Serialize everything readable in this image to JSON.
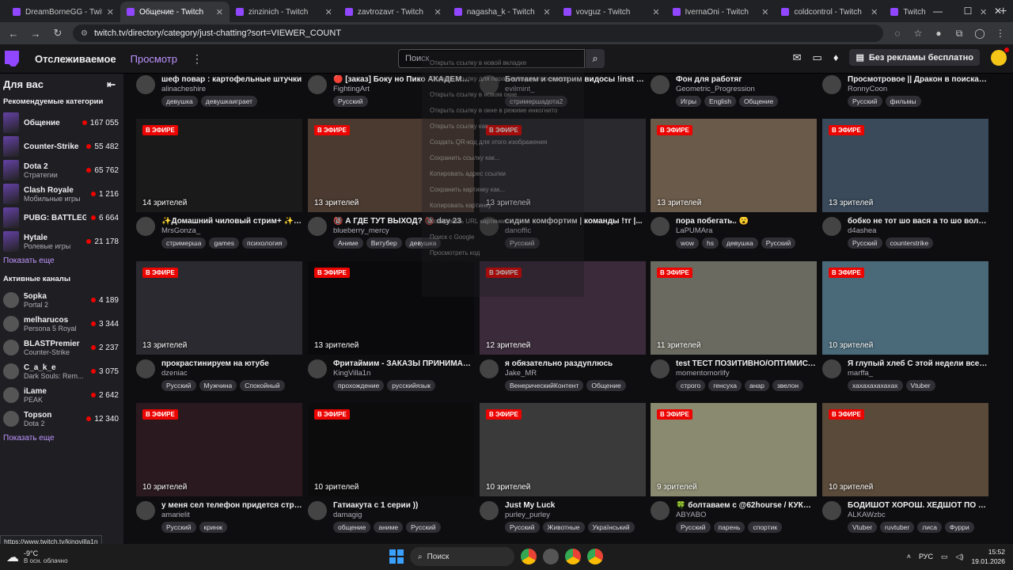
{
  "browser": {
    "tabs": [
      {
        "title": "DreamBorneGG - Twitch",
        "active": false
      },
      {
        "title": "Общение - Twitch",
        "active": true
      },
      {
        "title": "zinzinich - Twitch",
        "active": false
      },
      {
        "title": "zavtrozavr - Twitch",
        "active": false
      },
      {
        "title": "nagasha_k - Twitch",
        "active": false
      },
      {
        "title": "vovguz - Twitch",
        "active": false
      },
      {
        "title": "IvernaOni - Twitch",
        "active": false
      },
      {
        "title": "coldcontrol - Twitch",
        "active": false
      },
      {
        "title": "Twitch",
        "active": false
      }
    ],
    "url": "twitch.tv/directory/category/just-chatting?sort=VIEWER_COUNT",
    "status_url": "https://www.twitch.tv/kingvilla1n"
  },
  "header": {
    "following": "Отслеживаемое",
    "browse": "Просмотр",
    "search_placeholder": "Поиск",
    "no_ads": "Без рекламы бесплатно"
  },
  "sidebar": {
    "title": "Для вас",
    "rec_title": "Рекомендуемые категории",
    "categories": [
      {
        "name": "Общение",
        "meta": "",
        "count": "167 055"
      },
      {
        "name": "Counter-Strike",
        "meta": "",
        "count": "55 482"
      },
      {
        "name": "Dota 2",
        "meta": "Стратегии",
        "count": "65 762"
      },
      {
        "name": "Clash Royale",
        "meta": "Мобильные игры",
        "count": "1 216"
      },
      {
        "name": "PUBG: BATTLEG...",
        "meta": "",
        "count": "6 664"
      },
      {
        "name": "Hytale",
        "meta": "Ролевые игры",
        "count": "21 178"
      }
    ],
    "show_more": "Показать еще",
    "active_title": "Активные каналы",
    "channels": [
      {
        "name": "5opka",
        "meta": "Portal 2",
        "count": "4 189"
      },
      {
        "name": "melharucos",
        "meta": "Persona 5 Royal",
        "count": "3 344"
      },
      {
        "name": "BLASTPremier",
        "meta": "Counter-Strike",
        "count": "2 237"
      },
      {
        "name": "C_a_k_e",
        "meta": "Dark Souls: Rem...",
        "count": "3 075"
      },
      {
        "name": "iLame",
        "meta": "PEAK",
        "count": "2 642"
      },
      {
        "name": "Topson",
        "meta": "Dota 2",
        "count": "12 340"
      }
    ],
    "show_more2": "Показать еще"
  },
  "top_row": [
    {
      "title": "шеф повар : картофельные штучки",
      "name": "alinacheshire",
      "tags": [
        "девушка",
        "девушкаиграет"
      ]
    },
    {
      "title": "🔴 [заказ] Боку но Пико АКАДЕМИЯ ...",
      "name": "FightingArt",
      "tags": [
        "Русский"
      ]
    },
    {
      "title": "Болтаем и смотрим видосы !inst !tg ...",
      "name": "evilmint_",
      "tags": [
        "",
        "стримершадота2"
      ]
    },
    {
      "title": "Фон для работяг",
      "name": "Geometric_Progression",
      "tags": [
        "Игры",
        "English",
        "Общение"
      ]
    },
    {
      "title": "Просмотровое || Дракон в поисках ...",
      "name": "RonnyCoon",
      "tags": [
        "Русский",
        "фильмы"
      ]
    }
  ],
  "live_label": "В ЭФИРЕ",
  "rows": [
    [
      {
        "viewers": "14 зрителей",
        "title": "✨Домашний чиловый стрим+ ✨Ib...",
        "name": "MrsGonza_",
        "tags": [
          "стримерша",
          "games",
          "психология"
        ],
        "color": "#1a1a1a"
      },
      {
        "viewers": "13 зрителей",
        "title": "🔞 А ГДЕ ТУТ ВЫХОД? 🔞 day 23",
        "name": "blueberry_mercy",
        "tags": [
          "Аниме",
          "Витубер",
          "девушка"
        ],
        "color": "#4a3a30"
      },
      {
        "viewers": "13 зрителей",
        "title": "сидим комфортим | команды !тг |...",
        "name": "danoffic",
        "tags": [
          "Русский"
        ],
        "color": "#2a2a2e"
      },
      {
        "viewers": "13 зрителей",
        "title": "пора побегать.. 😮",
        "name": "LaPUMAra",
        "tags": [
          "wow",
          "hs",
          "девушка",
          "Русский"
        ],
        "color": "#6a5a4a"
      },
      {
        "viewers": "13 зрителей",
        "title": "бобко не тот шо вася а то шо волк | l...",
        "name": "d4ashea",
        "tags": [
          "Русский",
          "counterstrike"
        ],
        "color": "#3a4a5a"
      }
    ],
    [
      {
        "viewers": "13 зрителей",
        "title": "прокрастинируем на ютубе",
        "name": "dzeniac",
        "tags": [
          "Русский",
          "Мужчина",
          "Спокойный"
        ],
        "color": "#2a2a30"
      },
      {
        "viewers": "13 зрителей",
        "title": "Фритаймим - ЗАКАЗЫ ПРИНИМАЮ...",
        "name": "KingVilla1n",
        "tags": [
          "прохождение",
          "русскийязык"
        ],
        "color": "#0a0a0c"
      },
      {
        "viewers": "12 зрителей",
        "title": "я обязательно раздуплюсь",
        "name": "Jake_MR",
        "tags": [
          "ВенерическийКонтент",
          "Общение"
        ],
        "color": "#3a2a3a"
      },
      {
        "viewers": "11 зрителей",
        "title": "test ТЕСТ ПОЗИТИВНО/ОПТИМИСТ...",
        "name": "momentomorlify",
        "tags": [
          "строго",
          "генсуха",
          "анар",
          "звелон"
        ],
        "color": "#6a6a60"
      },
      {
        "viewers": "10 зрителей",
        "title": "Я глупый хлеб С этой недели все бу...",
        "name": "marffa_",
        "tags": [
          "хахахахахахах",
          "Vtuber"
        ],
        "color": "#4a6a7a"
      }
    ],
    [
      {
        "viewers": "10 зрителей",
        "title": "у меня сел телефон придется стрим...",
        "name": "amarielit",
        "tags": [
          "Русский",
          "кринж"
        ],
        "color": "#2a1a20"
      },
      {
        "viewers": "10 зрителей",
        "title": "Гатиакута с 1 серии ))",
        "name": "damagig",
        "tags": [
          "общение",
          "аниме",
          "Русский"
        ],
        "color": "#0c0c0c"
      },
      {
        "viewers": "10 зрителей",
        "title": "Just My Luck",
        "name": "purley_purley",
        "tags": [
          "Русский",
          "Животные",
          "Український"
        ],
        "color": "#3a3a3a"
      },
      {
        "viewers": "9 зрителей",
        "title": "🍀 болтаваем с @62hourse / КУКИНГ...",
        "name": "ABYABO",
        "tags": [
          "Русский",
          "парень",
          "спортик"
        ],
        "color": "#8a8a70"
      },
      {
        "viewers": "10 зрителей",
        "title": "БОДИШОТ ХОРОШ. ХЕДШОТ ПО ЖЕ...",
        "name": "ALKAWzbc",
        "tags": [
          "Vtuber",
          "ruvtuber",
          "лиса",
          "Фурри"
        ],
        "color": "#5a4a3a"
      }
    ]
  ],
  "context_menu": [
    "Открыть ссылку в новой вкладке",
    "Открыть ссылку для параллельного просмотра",
    "Открыть ссылку в новом окне",
    "Открыть ссылку в окне в режиме инкогнито",
    "Открыть ссылку как",
    "Создать QR-код для этого изображения",
    "Сохранить ссылку как...",
    "Копировать адрес ссылки",
    "Сохранить картинку как...",
    "Копировать картинку",
    "Копировать URL картинки",
    "Поиск с Google",
    "Просмотреть код"
  ],
  "taskbar": {
    "temp": "-9°C",
    "weather": "В осн. облачно",
    "search": "Поиск",
    "lang": "РУС",
    "time": "15:52",
    "date": "19.01.2026"
  }
}
